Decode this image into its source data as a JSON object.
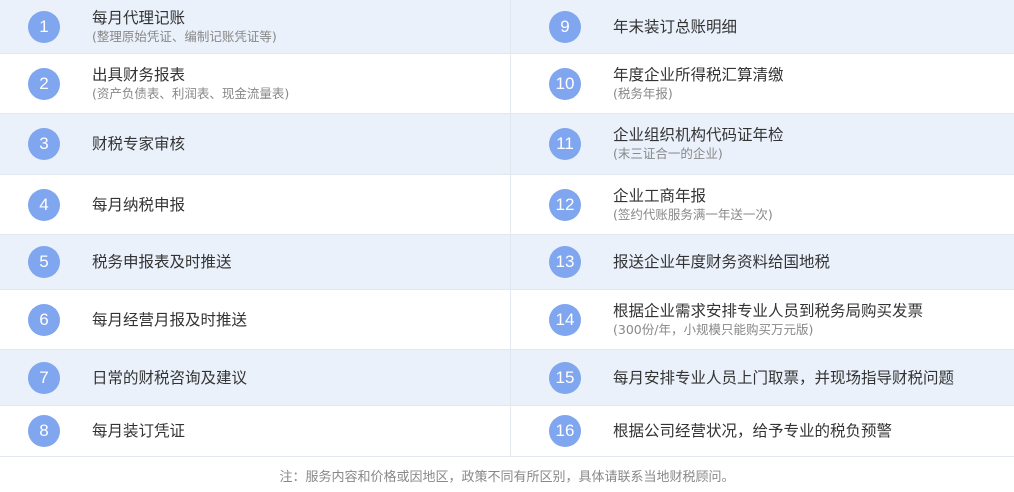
{
  "left_items": [
    {
      "number": "1",
      "title": "每月代理记账",
      "subtitle": "(整理原始凭证、编制记账凭证等)"
    },
    {
      "number": "2",
      "title": "出具财务报表",
      "subtitle": "(资产负债表、利润表、现金流量表)"
    },
    {
      "number": "3",
      "title": "财税专家审核",
      "subtitle": ""
    },
    {
      "number": "4",
      "title": "每月纳税申报",
      "subtitle": ""
    },
    {
      "number": "5",
      "title": "税务申报表及时推送",
      "subtitle": ""
    },
    {
      "number": "6",
      "title": "每月经营月报及时推送",
      "subtitle": ""
    },
    {
      "number": "7",
      "title": "日常的财税咨询及建议",
      "subtitle": ""
    },
    {
      "number": "8",
      "title": "每月装订凭证",
      "subtitle": ""
    }
  ],
  "right_items": [
    {
      "number": "9",
      "title": "年末装订总账明细",
      "subtitle": ""
    },
    {
      "number": "10",
      "title": "年度企业所得税汇算清缴",
      "subtitle": "(税务年报)"
    },
    {
      "number": "11",
      "title": "企业组织机构代码证年检",
      "subtitle": "(末三证合一的企业)"
    },
    {
      "number": "12",
      "title": "企业工商年报",
      "subtitle": "(签约代账服务满一年送一次)"
    },
    {
      "number": "13",
      "title": "报送企业年度财务资料给国地税",
      "subtitle": ""
    },
    {
      "number": "14",
      "title": "根据企业需求安排专业人员到税务局购买发票",
      "subtitle": "(300份/年，小规模只能购买万元版)"
    },
    {
      "number": "15",
      "title": "每月安排专业人员上门取票，并现场指导财税问题",
      "subtitle": ""
    },
    {
      "number": "16",
      "title": "根据公司经营状况，给予专业的税负预警",
      "subtitle": ""
    }
  ],
  "footer_note": "注：服务内容和价格或因地区，政策不同有所区别，具体请联系当地财税顾问。",
  "colors": {
    "badge": "#7fa6ee",
    "shaded_row": "#eaf1fb",
    "divider": "#e3e8ef"
  }
}
